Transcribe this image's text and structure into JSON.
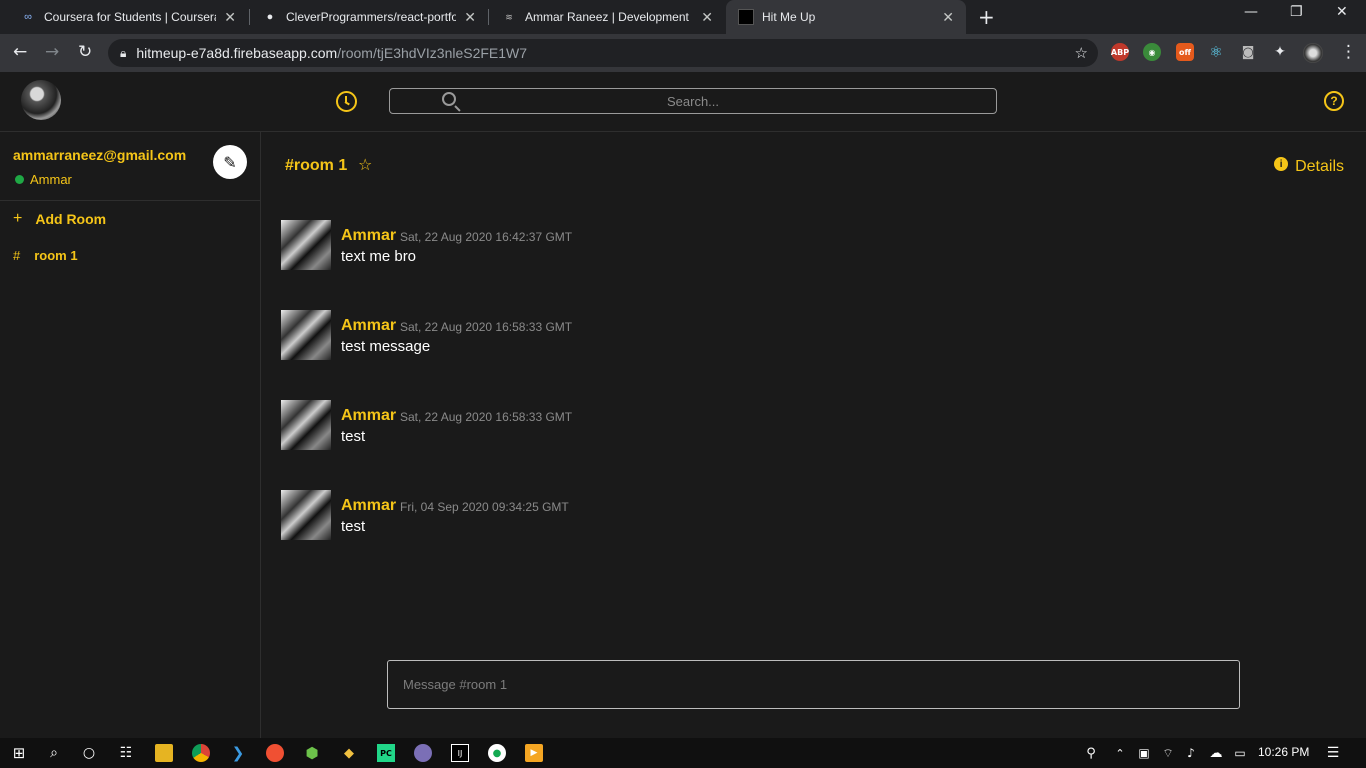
{
  "browser": {
    "tabs": [
      {
        "title": "Coursera for Students | Coursera",
        "icon": "coursera-icon"
      },
      {
        "title": "CleverProgrammers/react-portfo",
        "icon": "github-icon"
      },
      {
        "title": "Ammar Raneez | Development",
        "icon": "portfolio-icon"
      },
      {
        "title": "Hit Me Up",
        "icon": "hitmeup-icon"
      }
    ],
    "url_host": "hitmeup-e7a8d.firebaseapp.com",
    "url_path": "/room/tjE3hdVIz3nleS2FE1W7",
    "ext_abp": "ABP",
    "ext_pdf": "off"
  },
  "header": {
    "search_placeholder": "Search..."
  },
  "sidebar": {
    "email": "ammarraneez@gmail.com",
    "username": "Ammar",
    "add_room_label": "Add Room",
    "rooms": [
      {
        "name": "room 1"
      }
    ]
  },
  "chat": {
    "room_title": "#room 1",
    "details_label": "Details",
    "messages": [
      {
        "author": "Ammar",
        "time": "Sat, 22 Aug 2020 16:42:37 GMT",
        "text": "text me bro"
      },
      {
        "author": "Ammar",
        "time": "Sat, 22 Aug 2020 16:58:33 GMT",
        "text": "test message"
      },
      {
        "author": "Ammar",
        "time": "Sat, 22 Aug 2020 16:58:33 GMT",
        "text": "test"
      },
      {
        "author": "Ammar",
        "time": "Fri, 04 Sep 2020 09:34:25 GMT",
        "text": "test"
      }
    ],
    "composer_placeholder": "Message #room 1"
  },
  "taskbar": {
    "time": "10:26 PM"
  },
  "colors": {
    "accent": "#f5c518",
    "background": "#1a1a1a",
    "online": "#1fa845"
  }
}
